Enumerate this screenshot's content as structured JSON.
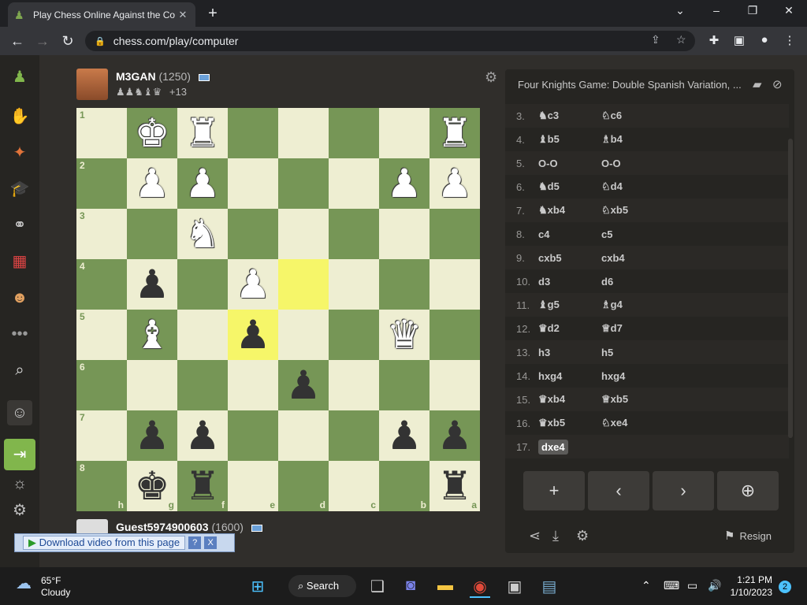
{
  "browser": {
    "tab_title": "Play Chess Online Against the Co",
    "url": "chess.com/play/computer"
  },
  "top_player": {
    "name": "M3GAN",
    "rating": "(1250)",
    "captured": "♟♟♞♝♛",
    "advantage": "+13"
  },
  "bottom_player": {
    "name": "Guest5974900603",
    "rating": "(1600)"
  },
  "board": {
    "ranks": [
      "1",
      "2",
      "3",
      "4",
      "5",
      "6",
      "7",
      "8"
    ],
    "files": [
      "h",
      "g",
      "f",
      "e",
      "d",
      "c",
      "b",
      "a"
    ],
    "rows": [
      [
        "",
        "wK",
        "wR",
        "",
        "",
        "",
        "",
        "wR"
      ],
      [
        "",
        "wP",
        "wP",
        "",
        "",
        "",
        "wP",
        "wP"
      ],
      [
        "",
        "",
        "wN",
        "",
        "",
        "",
        "",
        ""
      ],
      [
        "",
        "bP",
        "",
        "wP",
        "",
        "",
        "",
        ""
      ],
      [
        "",
        "wB",
        "",
        "bP",
        "",
        "",
        "wQ",
        ""
      ],
      [
        "",
        "",
        "",
        "",
        "bP",
        "",
        "",
        ""
      ],
      [
        "",
        "bP",
        "bP",
        "",
        "",
        "",
        "bP",
        "bP"
      ],
      [
        "",
        "bK",
        "bR",
        "",
        "",
        "",
        "",
        "bR"
      ]
    ],
    "highlight": [
      "3,4",
      "4,3"
    ]
  },
  "panel": {
    "opening": "Four Knights Game: Double Spanish Variation, ...",
    "moves": [
      {
        "n": "3.",
        "w": "♞c3",
        "b": "♘c6"
      },
      {
        "n": "4.",
        "w": "♝b5",
        "b": "♗b4"
      },
      {
        "n": "5.",
        "w": "O-O",
        "b": "O-O"
      },
      {
        "n": "6.",
        "w": "♞d5",
        "b": "♘d4"
      },
      {
        "n": "7.",
        "w": "♞xb4",
        "b": "♘xb5"
      },
      {
        "n": "8.",
        "w": "c4",
        "b": "c5"
      },
      {
        "n": "9.",
        "w": "cxb5",
        "b": "cxb4"
      },
      {
        "n": "10.",
        "w": "d3",
        "b": "d6"
      },
      {
        "n": "11.",
        "w": "♝g5",
        "b": "♗g4"
      },
      {
        "n": "12.",
        "w": "♛d2",
        "b": "♕d7"
      },
      {
        "n": "13.",
        "w": "h3",
        "b": "h5"
      },
      {
        "n": "14.",
        "w": "hxg4",
        "b": "hxg4"
      },
      {
        "n": "15.",
        "w": "♛xb4",
        "b": "♕xb5"
      },
      {
        "n": "16.",
        "w": "♛xb5",
        "b": "♘xe4"
      },
      {
        "n": "17.",
        "w": "dxe4",
        "b": ""
      }
    ],
    "resign_label": "Resign"
  },
  "download_bar": {
    "label": "Download video from this page",
    "help": "?",
    "close": "X"
  },
  "taskbar": {
    "temp": "65°F",
    "condition": "Cloudy",
    "search_label": "Search",
    "time": "1:21 PM",
    "date": "1/10/2023",
    "notifications": "2"
  }
}
